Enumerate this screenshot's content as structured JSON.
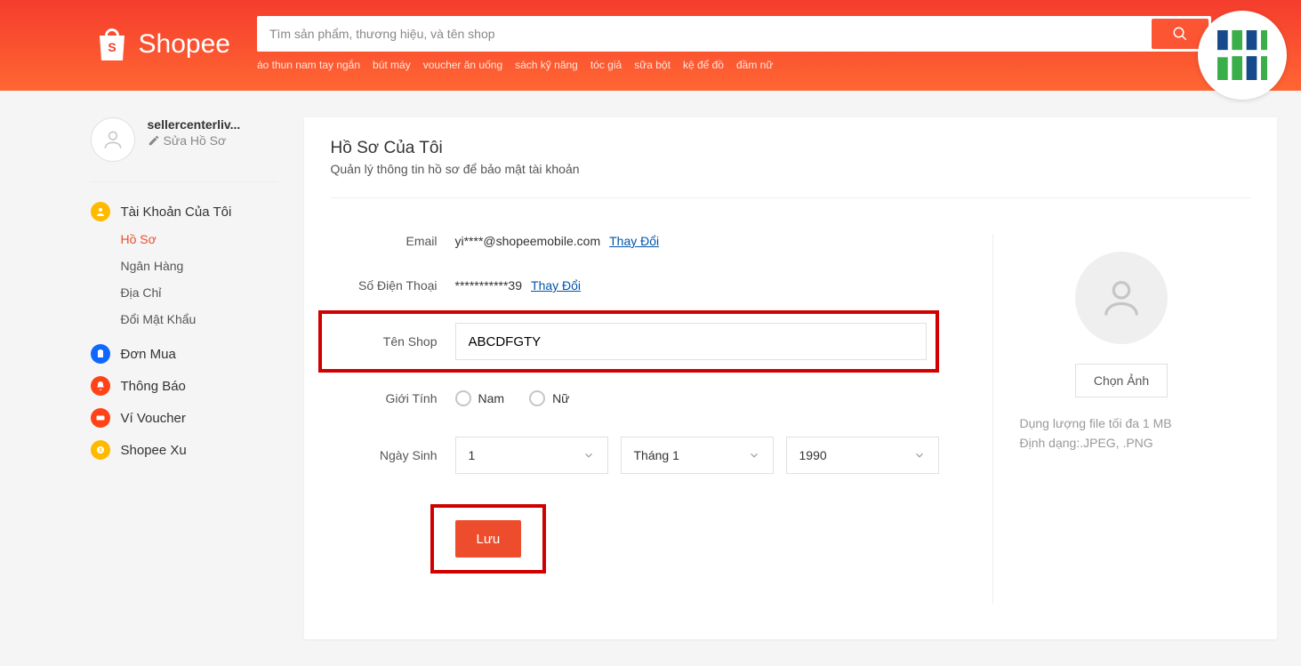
{
  "brand": "Shopee",
  "search": {
    "placeholder": "Tìm sản phẩm, thương hiệu, và tên shop"
  },
  "hot_links": [
    "áo thun nam tay ngắn",
    "bút máy",
    "voucher ăn uống",
    "sách kỹ năng",
    "tóc giả",
    "sữa bột",
    "kệ để đồ",
    "đầm nữ"
  ],
  "sidebar": {
    "username": "sellercenterliv...",
    "edit_label": "Sửa Hồ Sơ",
    "sections": [
      {
        "label": "Tài Khoản Của Tôi",
        "icon_bg": "#ffba00",
        "icon": "user",
        "subs": [
          {
            "label": "Hồ Sơ",
            "active": true
          },
          {
            "label": "Ngân Hàng",
            "active": false
          },
          {
            "label": "Địa Chỉ",
            "active": false
          },
          {
            "label": "Đổi Mật Khẩu",
            "active": false
          }
        ]
      },
      {
        "label": "Đơn Mua",
        "icon_bg": "#0f69ff",
        "icon": "clipboard",
        "subs": []
      },
      {
        "label": "Thông Báo",
        "icon_bg": "#ff4217",
        "icon": "bell",
        "subs": []
      },
      {
        "label": "Ví Voucher",
        "icon_bg": "#ff4217",
        "icon": "ticket",
        "subs": []
      },
      {
        "label": "Shopee Xu",
        "icon_bg": "#ffba00",
        "icon": "coin",
        "subs": []
      }
    ]
  },
  "content": {
    "title": "Hồ Sơ Của Tôi",
    "subtitle": "Quản lý thông tin hồ sơ để bảo mật tài khoản",
    "email_label": "Email",
    "email_value": "yi****@shopeemobile.com",
    "change_label": "Thay Đổi",
    "phone_label": "Số Điện Thoại",
    "phone_value": "***********39",
    "shopname_label": "Tên Shop",
    "shopname_value": "ABCDFGTY",
    "gender_label": "Giới Tính",
    "gender_options": [
      "Nam",
      "Nữ"
    ],
    "dob_label": "Ngày Sinh",
    "dob_day": "1",
    "dob_month": "Tháng 1",
    "dob_year": "1990",
    "save_label": "Lưu",
    "choose_image_label": "Chọn Ảnh",
    "hint_size": "Dụng lượng file tối đa 1 MB",
    "hint_format": "Định dạng:.JPEG, .PNG"
  }
}
